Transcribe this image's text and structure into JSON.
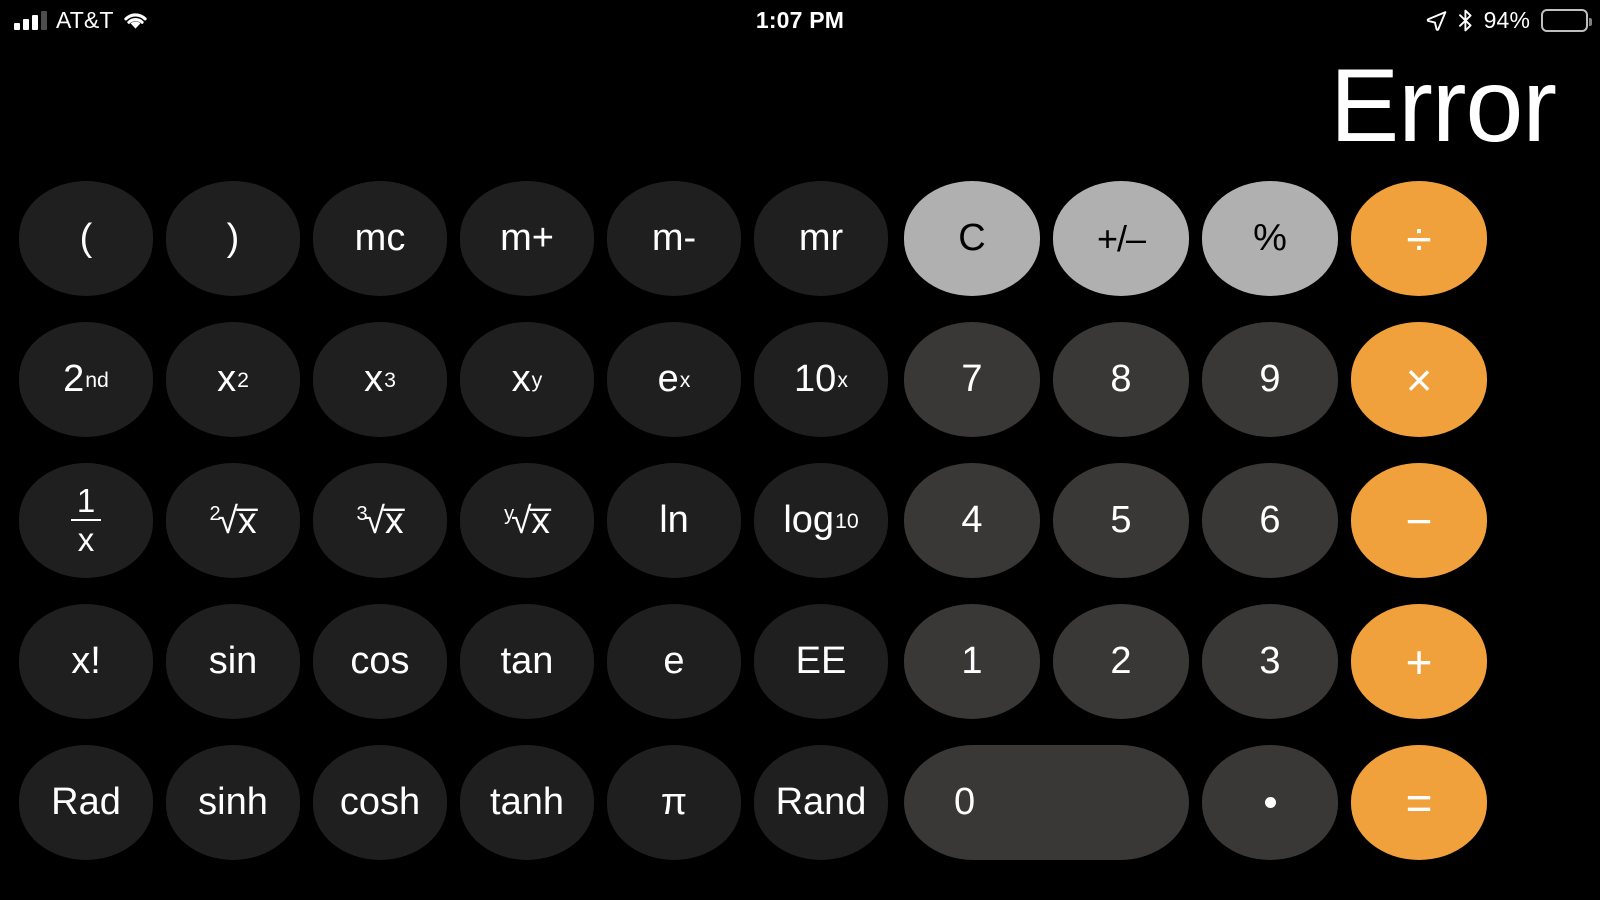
{
  "status_bar": {
    "carrier": "AT&T",
    "signal_icon": "cellular-bars-icon",
    "wifi_icon": "wifi-icon",
    "time": "1:07 PM",
    "location_icon": "location-arrow-icon",
    "bluetooth_icon": "bluetooth-icon",
    "battery_percent": "94%",
    "battery_icon": "battery-icon",
    "battery_level": 94
  },
  "display": {
    "value": "Error"
  },
  "theme": {
    "background": "#000000",
    "function_key": "#1f1f1f",
    "number_key": "#3a3836",
    "utility_key": "#b0b0b0",
    "operator_key": "#f0a13c",
    "text_light": "#ffffff",
    "text_dark": "#000000"
  },
  "keypad": {
    "rows": [
      {
        "keys": [
          {
            "label": "(",
            "name": "open-paren",
            "type": "fn"
          },
          {
            "label": ")",
            "name": "close-paren",
            "type": "fn"
          },
          {
            "label": "mc",
            "name": "memory-clear",
            "type": "fn"
          },
          {
            "label": "m+",
            "name": "memory-add",
            "type": "fn"
          },
          {
            "label": "m-",
            "name": "memory-subtract",
            "type": "fn"
          },
          {
            "label": "mr",
            "name": "memory-recall",
            "type": "fn"
          },
          {
            "label": "C",
            "name": "clear",
            "type": "gray"
          },
          {
            "label": "+/–",
            "name": "sign-toggle",
            "type": "gray"
          },
          {
            "label": "%",
            "name": "percent",
            "type": "gray"
          },
          {
            "label": "÷",
            "name": "divide",
            "type": "op"
          }
        ]
      },
      {
        "keys": [
          {
            "label": "2nd",
            "base": "2",
            "sup": "nd",
            "name": "second-function",
            "type": "fn"
          },
          {
            "label": "x2",
            "base": "x",
            "sup": "2",
            "name": "x-squared",
            "type": "fn"
          },
          {
            "label": "x3",
            "base": "x",
            "sup": "3",
            "name": "x-cubed",
            "type": "fn"
          },
          {
            "label": "xy",
            "base": "x",
            "sup": "y",
            "name": "x-power-y",
            "type": "fn"
          },
          {
            "label": "ex",
            "base": "e",
            "sup": "x",
            "name": "e-power-x",
            "type": "fn"
          },
          {
            "label": "10x",
            "base": "10",
            "sup": "x",
            "name": "ten-power-x",
            "type": "fn"
          },
          {
            "label": "7",
            "name": "digit-7",
            "type": "num"
          },
          {
            "label": "8",
            "name": "digit-8",
            "type": "num"
          },
          {
            "label": "9",
            "name": "digit-9",
            "type": "num"
          },
          {
            "label": "×",
            "name": "multiply",
            "type": "op"
          }
        ]
      },
      {
        "keys": [
          {
            "label": "1/x",
            "numerator": "1",
            "denominator": "x",
            "name": "reciprocal",
            "type": "fn"
          },
          {
            "label": "2√x",
            "index": "2",
            "name": "square-root",
            "type": "fn"
          },
          {
            "label": "3√x",
            "index": "3",
            "name": "cube-root",
            "type": "fn"
          },
          {
            "label": "y√x",
            "index": "y",
            "name": "nth-root",
            "type": "fn"
          },
          {
            "label": "ln",
            "name": "natural-log",
            "type": "fn"
          },
          {
            "label": "log10",
            "base": "log",
            "sub": "10",
            "name": "log-base-10",
            "type": "fn"
          },
          {
            "label": "4",
            "name": "digit-4",
            "type": "num"
          },
          {
            "label": "5",
            "name": "digit-5",
            "type": "num"
          },
          {
            "label": "6",
            "name": "digit-6",
            "type": "num"
          },
          {
            "label": "−",
            "name": "subtract",
            "type": "op"
          }
        ]
      },
      {
        "keys": [
          {
            "label": "x!",
            "name": "factorial",
            "type": "fn"
          },
          {
            "label": "sin",
            "name": "sine",
            "type": "fn"
          },
          {
            "label": "cos",
            "name": "cosine",
            "type": "fn"
          },
          {
            "label": "tan",
            "name": "tangent",
            "type": "fn"
          },
          {
            "label": "e",
            "name": "euler-constant",
            "type": "fn"
          },
          {
            "label": "EE",
            "name": "exponent-entry",
            "type": "fn"
          },
          {
            "label": "1",
            "name": "digit-1",
            "type": "num"
          },
          {
            "label": "2",
            "name": "digit-2",
            "type": "num"
          },
          {
            "label": "3",
            "name": "digit-3",
            "type": "num"
          },
          {
            "label": "+",
            "name": "add",
            "type": "op"
          }
        ]
      },
      {
        "keys": [
          {
            "label": "Rad",
            "name": "radian-mode",
            "type": "fn"
          },
          {
            "label": "sinh",
            "name": "hyperbolic-sine",
            "type": "fn"
          },
          {
            "label": "cosh",
            "name": "hyperbolic-cosine",
            "type": "fn"
          },
          {
            "label": "tanh",
            "name": "hyperbolic-tangent",
            "type": "fn"
          },
          {
            "label": "π",
            "name": "pi-constant",
            "type": "fn"
          },
          {
            "label": "Rand",
            "name": "random-number",
            "type": "fn"
          },
          {
            "label": "0",
            "name": "digit-0",
            "type": "zero"
          },
          {
            "label": ".",
            "name": "decimal-point",
            "type": "num"
          },
          {
            "label": "=",
            "name": "equals",
            "type": "op"
          }
        ]
      }
    ]
  }
}
